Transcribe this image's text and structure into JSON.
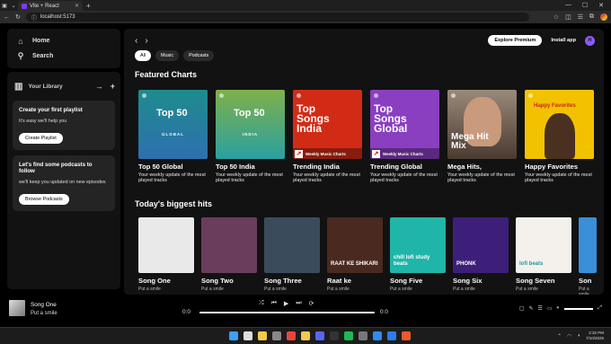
{
  "browser": {
    "tab_title": "Vite + React",
    "url": "localhost:5173"
  },
  "sidebar": {
    "home": "Home",
    "search": "Search",
    "library": "Your Library",
    "playlist_card": {
      "title": "Create your first playlist",
      "text": "It's easy we'll help you",
      "button": "Create Playlist"
    },
    "podcast_card": {
      "title": "Let's find some podcasts to follow",
      "text": "we'll keep you updated on new episodes",
      "button": "Browse Podcasts"
    }
  },
  "topbar": {
    "explore": "Explore Premium",
    "install": "Install app",
    "avatar": "H"
  },
  "chips": [
    "All",
    "Music",
    "Podcasts"
  ],
  "featured": {
    "title": "Featured Charts",
    "items": [
      {
        "name": "Top 50 Global",
        "desc": "Your weekly update of the most played tracks",
        "cover_title": "Top 50",
        "cover_sub": "GLOBAL",
        "color": "#1e8c8c"
      },
      {
        "name": "Top 50 India",
        "desc": "Your weekly update of the most played tracks",
        "cover_title": "Top 50",
        "cover_sub": "INDIA",
        "color": "#7fb04a"
      },
      {
        "name": "Trending India",
        "desc": "Your weekly update of the most played tracks",
        "cover_title": "Top Songs India",
        "cover_sub": "Weekly Music Charts",
        "color": "#d12b16"
      },
      {
        "name": "Trending Global",
        "desc": "Your weekly update of the most played tracks",
        "cover_title": "Top Songs Global",
        "cover_sub": "Weekly Music Charts",
        "color": "#8a3fc0"
      },
      {
        "name": "Mega Hits,",
        "desc": "Your weekly update of the most played tracks",
        "cover_title": "Mega Hit Mix",
        "cover_sub": "",
        "color": "#6a4a38"
      },
      {
        "name": "Happy Favorites",
        "desc": "Your weekly update of the most played tracks",
        "cover_title": "Happy Favorites",
        "cover_sub": "",
        "color": "#f2c200"
      }
    ]
  },
  "hits": {
    "title": "Today's biggest hits",
    "items": [
      {
        "name": "Song One",
        "sub": "Put a smile",
        "color": "#e9e9e9",
        "cover_text": ""
      },
      {
        "name": "Song Two",
        "sub": "Put a smile",
        "color": "#6a3d5c",
        "cover_text": ""
      },
      {
        "name": "Song Three",
        "sub": "Put a smile",
        "color": "#3a4c5c",
        "cover_text": ""
      },
      {
        "name": "Raat ke",
        "sub": "Put a smile",
        "color": "#4a2a20",
        "cover_text": "RAAT KE SHIKARI"
      },
      {
        "name": "Song Five",
        "sub": "Put a smile",
        "color": "#1fb5a8",
        "cover_text": "chill lofi study beats"
      },
      {
        "name": "Song Six",
        "sub": "Put a smile",
        "color": "#3d1f7a",
        "cover_text": "PHONK"
      },
      {
        "name": "Song Seven",
        "sub": "Put a smile",
        "color": "#f4f0ec",
        "cover_text": "lofi beats"
      },
      {
        "name": "Son",
        "sub": "Put a smile",
        "color": "#3a8fd8",
        "cover_text": ""
      }
    ]
  },
  "player": {
    "title": "Song One",
    "artist": "Put a smile",
    "time_current": "0:0",
    "time_total": "0:0"
  },
  "taskbar": {
    "time": "2:32 PM",
    "date": "7/10/2025"
  }
}
